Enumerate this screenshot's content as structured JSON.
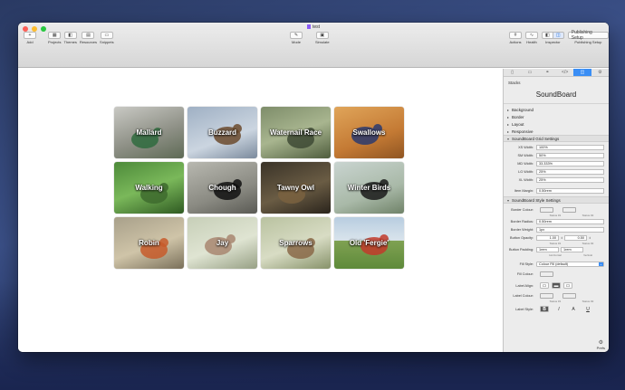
{
  "window": {
    "title": "test"
  },
  "toolbar": {
    "left": [
      {
        "label": "Add",
        "icon": "plus-icon",
        "glyph": "+"
      },
      {
        "label": "Projects",
        "icon": "projects-icon",
        "glyph": "▦"
      },
      {
        "label": "Themes",
        "icon": "themes-icon",
        "glyph": "◧"
      },
      {
        "label": "Resources",
        "icon": "resources-icon",
        "glyph": "▤"
      },
      {
        "label": "Snippets",
        "icon": "snippets-icon",
        "glyph": "▭"
      }
    ],
    "center": [
      {
        "label": "Mode",
        "icon": "pencil-icon",
        "glyph": "✎"
      },
      {
        "label": "Simulate",
        "icon": "simulate-icon",
        "glyph": "▣"
      }
    ],
    "right": [
      {
        "label": "Actions",
        "icon": "hash-icon",
        "glyph": "#"
      },
      {
        "label": "Health",
        "icon": "health-icon",
        "glyph": "∿"
      },
      {
        "label": "Inspector",
        "icon": "inspector-icon",
        "glyph": "◫"
      }
    ],
    "publishing": {
      "label": "Publishing Setup",
      "button": "Publishing Setup"
    }
  },
  "tiles": [
    {
      "label": "Mallard",
      "bg": "linear-gradient(160deg,#c9c9c4,#8f9187 55%,#5e6a55)",
      "bird": "#2f6b3e"
    },
    {
      "label": "Buzzard",
      "bg": "linear-gradient(160deg,#9fb0c4,#cbd5e0 60%,#7b8a9c)",
      "bird": "#6b4a2d"
    },
    {
      "label": "Waternail Race",
      "bg": "linear-gradient(160deg,#7e8d6a,#a8b58f 50%,#4f5d3d)",
      "bird": "#3e4a35"
    },
    {
      "label": "Swallows",
      "bg": "linear-gradient(160deg,#e0a55a,#c47a34 60%,#8f5522)",
      "bird": "#2a3a6e"
    },
    {
      "label": "Walking",
      "bg": "linear-gradient(160deg,#4d8a3a,#7ab85a 50%,#2f5a22)",
      "bird": "#3e6b2e"
    },
    {
      "label": "Chough",
      "bg": "linear-gradient(160deg,#b8b8b0,#8a8a82 60%,#5a5a54)",
      "bird": "#111111"
    },
    {
      "label": "Tawny Owl",
      "bg": "linear-gradient(160deg,#3a3328,#6a5c44 55%,#2a241c)",
      "bird": "#7a6140"
    },
    {
      "label": "Winter Birds",
      "bg": "linear-gradient(160deg,#c9d4d0,#a9b9a8 60%,#6f8268)",
      "bird": "#1a1a1a"
    },
    {
      "label": "Robin",
      "bg": "linear-gradient(160deg,#a8a08a,#cfc4a8 55%,#7a705a)",
      "bird": "#c75a2a"
    },
    {
      "label": "Jay",
      "bg": "linear-gradient(160deg,#c7cfb8,#dfe4d2 55%,#97a085)",
      "bird": "#a88670"
    },
    {
      "label": "Sparrows",
      "bg": "linear-gradient(160deg,#b9c2a0,#d8dcc4 55%,#87926a)",
      "bird": "#8a6848"
    },
    {
      "label": "Old 'Fergie'",
      "bg": "linear-gradient(180deg,#b8cde0 0%,#d9e4ec 45%,#7fa152 46%,#5e8a3a 100%)",
      "bird": "#c23a2a"
    }
  ],
  "inspector": {
    "tabs": [
      "page-icon",
      "layout-icon",
      "link-icon",
      "code-icon",
      "stack-icon",
      "settings-icon"
    ],
    "tab_glyphs": [
      "▯",
      "▭",
      "⚭",
      "</>",
      "◫",
      "⚙"
    ],
    "section": "Stacks",
    "brand": "SoundBoard",
    "collapsed": [
      "Background",
      "Border",
      "Layout",
      "Responsive"
    ],
    "grid_group": "SoundBoard Grid Settings",
    "grid_rows": [
      {
        "label": "XS Width:",
        "value": "100%"
      },
      {
        "label": "SM Width:",
        "value": "50%"
      },
      {
        "label": "MD Width:",
        "value": "33.333%"
      },
      {
        "label": "LG Width:",
        "value": "25%"
      },
      {
        "label": "XL Width:",
        "value": "25%"
      }
    ],
    "item_margin": {
      "label": "Item Margin:",
      "value": "0.50rem"
    },
    "style_group": "SoundBoard Style Settings",
    "border_colour": {
      "label": "Border Colour:",
      "status1": "Status #1",
      "status2": "Status #2"
    },
    "border_radius": {
      "label": "Border Radius:",
      "value": "0.50rem"
    },
    "border_weight": {
      "label": "Border Weight:",
      "value": "1px"
    },
    "button_opacity": {
      "label": "Button Opacity:",
      "v1": "1.00",
      "v2": "0.50",
      "s1": "Status #1",
      "s2": "Status #2"
    },
    "button_padding": {
      "label": "Button Padding:",
      "v1": "1rem",
      "v2": "1rem",
      "s1": "Horizontal",
      "s2": "Vertical"
    },
    "fill_style": {
      "label": "Fill Style:",
      "value": "Colour Fill (default)"
    },
    "fill_colour": {
      "label": "Fill Colour:"
    },
    "label_align": {
      "label": "Label Align:"
    },
    "label_colour": {
      "label": "Label Colour:",
      "s1": "Status #1",
      "s2": "Status #2"
    },
    "label_style": {
      "label": "Label Style:"
    },
    "prefs": "Prefs"
  }
}
